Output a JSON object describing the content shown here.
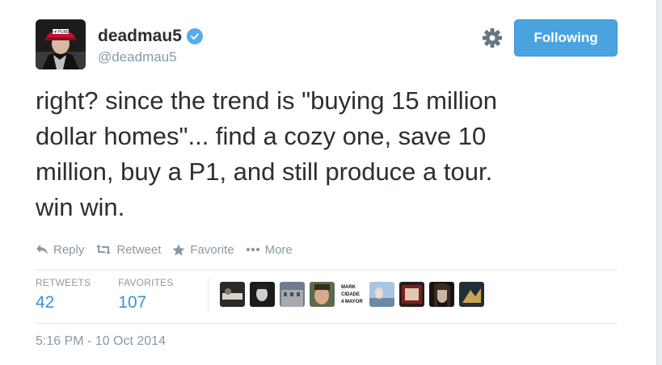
{
  "user": {
    "display_name": "deadmau5",
    "handle": "@deadmau5",
    "verified": true,
    "avatar_hat_text": "I ♥ PURE"
  },
  "header": {
    "gear_icon": "gear-icon",
    "follow_label": "Following"
  },
  "tweet": {
    "lines": [
      "right? since the trend is \"buying 15 million",
      "dollar homes\"... find a cozy one, save 10",
      "million, buy a P1, and still produce a tour.",
      "win win."
    ]
  },
  "actions": [
    {
      "icon": "reply-icon",
      "label": "Reply"
    },
    {
      "icon": "retweet-icon",
      "label": "Retweet"
    },
    {
      "icon": "star-icon",
      "label": "Favorite"
    },
    {
      "icon": "more-dots-icon",
      "label": "More"
    }
  ],
  "stats": {
    "retweets_label": "RETWEETS",
    "retweets_value": "42",
    "favorites_label": "FAVORITES",
    "favorites_value": "107"
  },
  "favoriters": [
    {
      "type": "photo"
    },
    {
      "type": "photo"
    },
    {
      "type": "photo"
    },
    {
      "type": "photo"
    },
    {
      "type": "text",
      "lines": [
        "MARK",
        "CIDADE",
        "4 MAYOR"
      ]
    },
    {
      "type": "photo"
    },
    {
      "type": "photo"
    },
    {
      "type": "photo"
    },
    {
      "type": "photo"
    }
  ],
  "timestamp": "5:16 PM - 10 Oct 2014",
  "colors": {
    "follow_button": "#4aa3df",
    "link_blue": "#3b94d9",
    "muted_gray": "#8899a6",
    "text": "#292f33",
    "verified_blue": "#55acee"
  }
}
